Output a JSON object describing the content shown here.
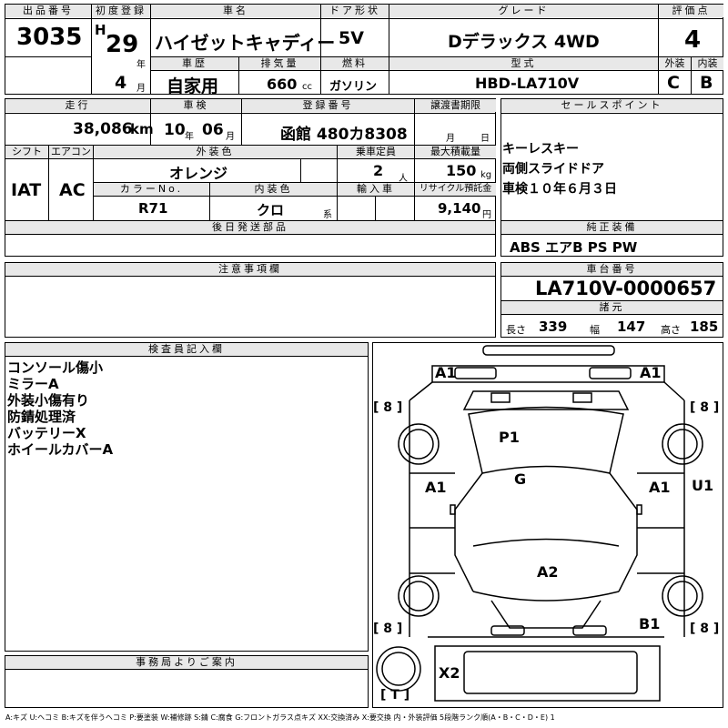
{
  "header": {
    "lot_label": "出品番号",
    "lot": "3035",
    "first_reg_label": "初度登録",
    "era": "H",
    "year": "29",
    "year_unit": "年",
    "month": "4",
    "month_unit": "月",
    "name_label": "車名",
    "name": "ハイゼットキャディー",
    "door_label": "ドア形状",
    "door": "5V",
    "grade_label": "グレード",
    "grade": "Dデラックス 4WD",
    "score_label": "評価点",
    "score": "4",
    "history_label": "車歴",
    "history": "自家用",
    "displacement_label": "排気量",
    "displacement": "660",
    "displacement_unit": "cc",
    "fuel_label": "燃料",
    "fuel": "ガソリン",
    "model_label": "型式",
    "model": "HBD-LA710V",
    "exterior_label": "外装",
    "exterior": "C",
    "interior_label": "内装",
    "interior": "B"
  },
  "details": {
    "mileage_label": "走行",
    "mileage": "38,086",
    "mileage_unit": "km",
    "inspection_label": "車検",
    "insp_year": "10",
    "insp_year_unit": "年",
    "insp_month": "06",
    "insp_month_unit": "月",
    "plate_label": "登録番号",
    "plate": "函館 480カ8308",
    "transfer_label": "譲渡書期限",
    "transfer_month_unit": "月",
    "transfer_day_unit": "日",
    "shift_label": "シフト",
    "shift": "IAT",
    "ac_label": "エアコン",
    "ac": "AC",
    "color_label": "外装色",
    "color": "オレンジ",
    "capacity_label": "乗車定員",
    "capacity": "2",
    "capacity_unit": "人",
    "load_label": "最大積載量",
    "load": "150",
    "load_unit": "kg",
    "color_no_label": "カラーNo.",
    "color_no": "R71",
    "int_color_label": "内装色",
    "int_color": "クロ",
    "int_color_unit": "系",
    "import_label": "輸入車",
    "recycle_label": "リサイクル預託金",
    "recycle": "9,140",
    "recycle_unit": "円",
    "later_parts_label": "後日発送部品"
  },
  "sales": {
    "label": "セールスポイント",
    "points": [
      "キーレスキー",
      "両側スライドドア",
      "車検１０年６月３日"
    ]
  },
  "equipment": {
    "label": "純正装備",
    "value": "ABS エアB PS PW"
  },
  "notes": {
    "label": "注意事項欄"
  },
  "chassis": {
    "label": "車台番号",
    "value": "LA710V-0000657"
  },
  "specs": {
    "label": "諸元",
    "length_label": "長さ",
    "length": "339",
    "width_label": "幅",
    "width": "147",
    "height_label": "高さ",
    "height": "185"
  },
  "inspector": {
    "label": "検査員記入欄",
    "lines": [
      "コンソール傷小",
      "ミラーA",
      "外装小傷有り",
      "防錆処理済",
      "バッテリーX",
      "ホイールカバーA"
    ]
  },
  "office": {
    "label": "事務局よりご案内"
  },
  "diagram_labels": {
    "a1_tl": "A1",
    "a1_tr": "A1",
    "p1": "P1",
    "g": "G",
    "a1_ml": "A1",
    "a1_mr": "A1",
    "u1": "U1",
    "a2": "A2",
    "b1": "B1",
    "x2": "X2",
    "t": "[ T ]",
    "b8": "[ 8 ]"
  },
  "legend": "A:キズ U:ヘコミ B:キズを伴うヘコミ P:要塗装 W:補修跡 S:錆 C:腐食 G:フロントガラス点キズ XX:交換済み X:要交換 内・外装評価 5段階ランク順(A・B・C・D・E) 1"
}
